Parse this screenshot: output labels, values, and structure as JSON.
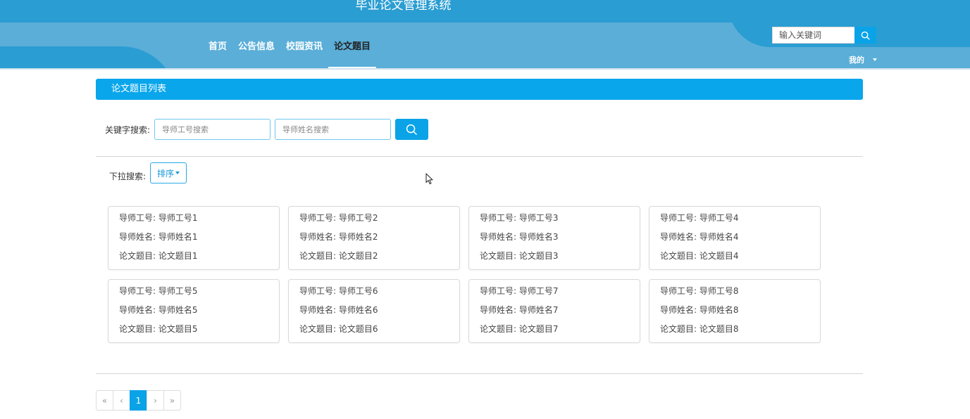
{
  "header": {
    "title": "毕业论文管理系统",
    "nav": [
      {
        "label": "首页",
        "active": false
      },
      {
        "label": "公告信息",
        "active": false
      },
      {
        "label": "校园资讯",
        "active": false
      },
      {
        "label": "论文题目",
        "active": true
      }
    ],
    "search_placeholder": "输入关键词",
    "user_menu": "我的"
  },
  "section_title": "论文题目列表",
  "keyword_search": {
    "label": "关键字搜索:",
    "teacher_id_placeholder": "导师工号搜索",
    "teacher_name_placeholder": "导师姓名搜索"
  },
  "dropdown_search": {
    "label": "下拉搜索:",
    "sort_label": "排序"
  },
  "fields": {
    "teacher_id": "导师工号:",
    "teacher_name": "导师姓名:",
    "topic": "论文题目:"
  },
  "cards": [
    {
      "teacher_id": "导师工号1",
      "teacher_name": "导师姓名1",
      "topic": "论文题目1"
    },
    {
      "teacher_id": "导师工号2",
      "teacher_name": "导师姓名2",
      "topic": "论文题目2"
    },
    {
      "teacher_id": "导师工号3",
      "teacher_name": "导师姓名3",
      "topic": "论文题目3"
    },
    {
      "teacher_id": "导师工号4",
      "teacher_name": "导师姓名4",
      "topic": "论文题目4"
    },
    {
      "teacher_id": "导师工号5",
      "teacher_name": "导师姓名5",
      "topic": "论文题目5"
    },
    {
      "teacher_id": "导师工号6",
      "teacher_name": "导师姓名6",
      "topic": "论文题目6"
    },
    {
      "teacher_id": "导师工号7",
      "teacher_name": "导师姓名7",
      "topic": "论文题目7"
    },
    {
      "teacher_id": "导师工号8",
      "teacher_name": "导师姓名8",
      "topic": "论文题目8"
    }
  ],
  "pagination": {
    "first": "«",
    "prev": "‹",
    "current": "1",
    "next": "›",
    "last": "»"
  },
  "colors": {
    "header_light": "#5aaed8",
    "header_dark": "#2a9dd2",
    "accent": "#0aa3e7"
  }
}
